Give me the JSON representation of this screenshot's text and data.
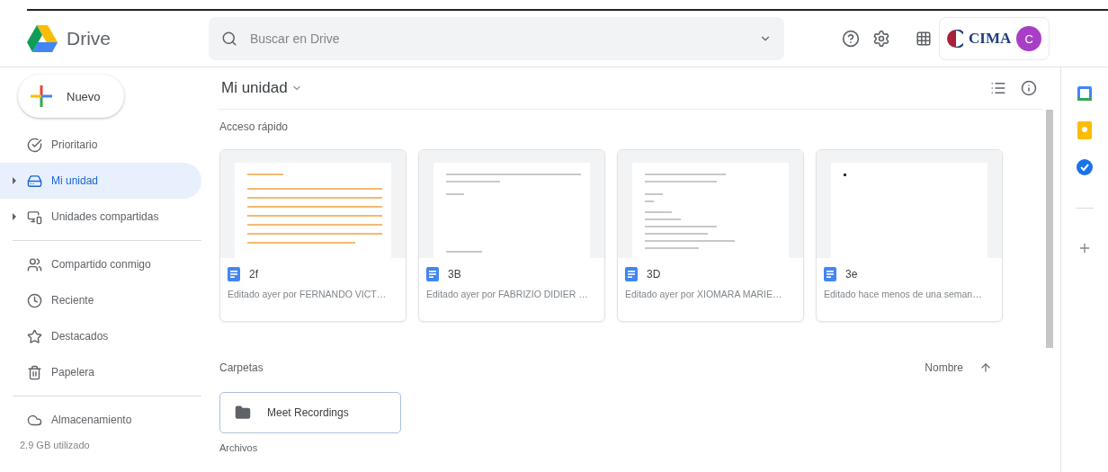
{
  "app": {
    "name": "Drive"
  },
  "search": {
    "placeholder": "Buscar en Drive"
  },
  "account": {
    "org": "CIMA",
    "avatar": "C"
  },
  "new_button": {
    "label": "Nuevo"
  },
  "sidebar": {
    "groups": [
      [
        {
          "label": "Prioritario",
          "selected": false,
          "expandable": false
        },
        {
          "label": "Mi unidad",
          "selected": true,
          "expandable": true
        },
        {
          "label": "Unidades compartidas",
          "selected": false,
          "expandable": true
        }
      ],
      [
        {
          "label": "Compartido conmigo",
          "selected": false,
          "expandable": false
        },
        {
          "label": "Reciente",
          "selected": false,
          "expandable": false
        },
        {
          "label": "Destacados",
          "selected": false,
          "expandable": false
        },
        {
          "label": "Papelera",
          "selected": false,
          "expandable": false
        }
      ],
      [
        {
          "label": "Almacenamiento",
          "selected": false,
          "expandable": false
        }
      ]
    ],
    "storage_usage": "2.9 GB utilizado"
  },
  "main": {
    "title": "Mi unidad",
    "quick_access": {
      "heading": "Acceso rápido",
      "files": [
        {
          "name": "2f",
          "edited": "Editado ayer por FERNANDO VICT…"
        },
        {
          "name": "3B",
          "edited": "Editado ayer por FABRIZIO DIDIER …"
        },
        {
          "name": "3D",
          "edited": "Editado ayer por XIOMARA MARIE…"
        },
        {
          "name": "3e",
          "edited": "Editado hace menos de una seman…"
        }
      ]
    },
    "folders": {
      "heading": "Carpetas",
      "sort": "Nombre",
      "items": [
        {
          "name": "Meet Recordings"
        }
      ]
    },
    "files": {
      "heading": "Archivos"
    }
  }
}
